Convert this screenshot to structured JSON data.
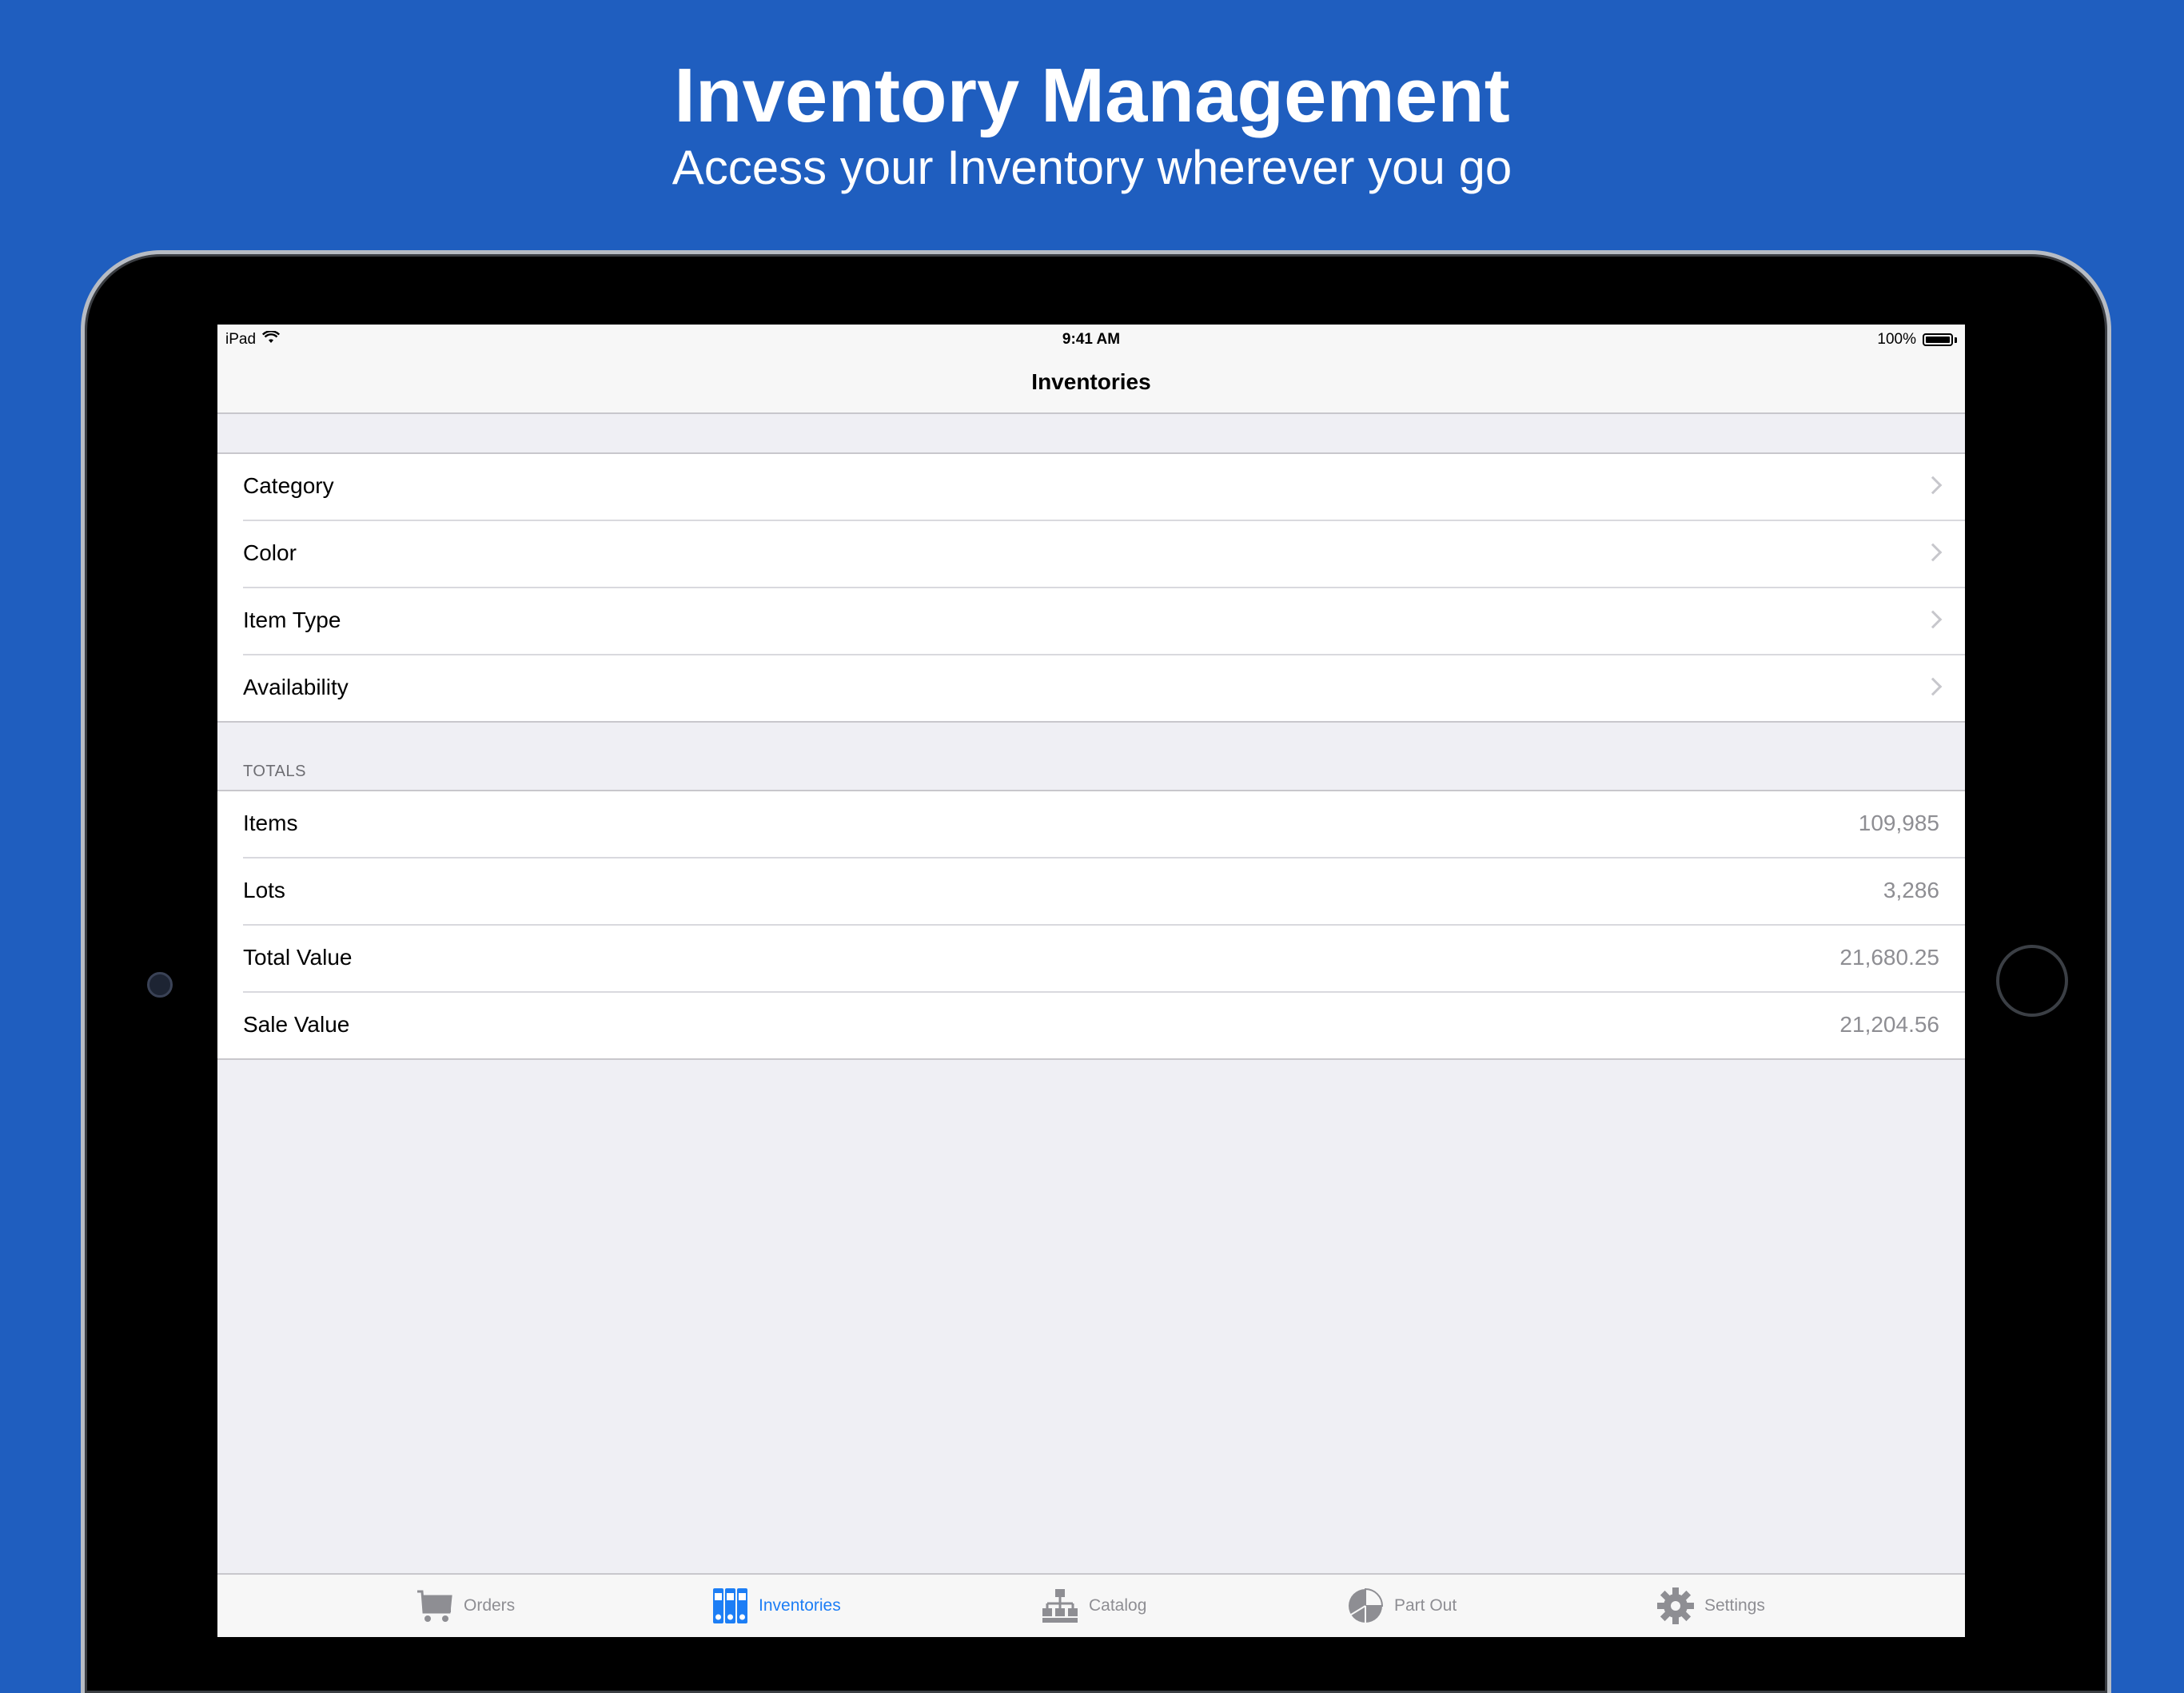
{
  "hero": {
    "title": "Inventory Management",
    "subtitle": "Access your Inventory wherever you go"
  },
  "status_bar": {
    "device": "iPad",
    "time": "9:41 AM",
    "battery": "100%"
  },
  "nav": {
    "title": "Inventories"
  },
  "filters": [
    {
      "label": "Category"
    },
    {
      "label": "Color"
    },
    {
      "label": "Item Type"
    },
    {
      "label": "Availability"
    }
  ],
  "totals": {
    "header": "TOTALS",
    "rows": [
      {
        "label": "Items",
        "value": "109,985"
      },
      {
        "label": "Lots",
        "value": "3,286"
      },
      {
        "label": "Total Value",
        "value": "21,680.25"
      },
      {
        "label": "Sale Value",
        "value": "21,204.56"
      }
    ]
  },
  "tabs": [
    {
      "label": "Orders",
      "icon": "cart-icon",
      "active": false
    },
    {
      "label": "Inventories",
      "icon": "binders-icon",
      "active": true
    },
    {
      "label": "Catalog",
      "icon": "hierarchy-icon",
      "active": false
    },
    {
      "label": "Part Out",
      "icon": "pie-chart-icon",
      "active": false
    },
    {
      "label": "Settings",
      "icon": "gear-icon",
      "active": false
    }
  ],
  "colors": {
    "background": "#1f5ebf",
    "accent": "#1d7ef5",
    "inactive_tab": "#8e8e93",
    "value_text": "#8e8e93"
  }
}
